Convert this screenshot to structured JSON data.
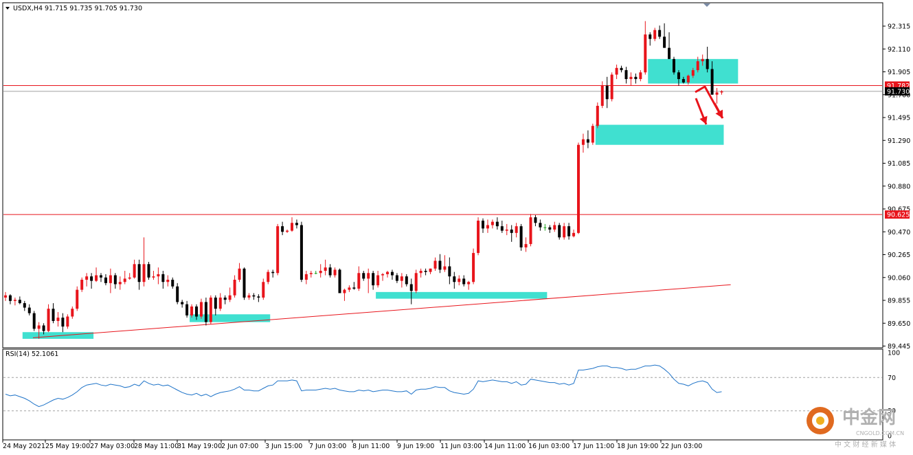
{
  "header": {
    "symbol": "USDX,H4",
    "ohlc": "91.715 91.735 91.705 91.730"
  },
  "rsi": {
    "label": "RSI(14) 52.1061",
    "levels": [
      100,
      70,
      30,
      0
    ]
  },
  "price_labels": {
    "resistance_high": "91.782",
    "current": "91.730",
    "resistance_low": "90.625"
  },
  "colors": {
    "bull": "#e8141b",
    "bear": "#000000",
    "doji": "#19a019",
    "zone": "#40e0d0",
    "line": "#e8141b",
    "rsi": "#1e73c8"
  },
  "watermark": {
    "brand": "中金网",
    "sub": "中 文 财 经 新 媒 体",
    "url": "CNGOLD.COM.CN"
  },
  "chart_data": [
    {
      "type": "candlestick",
      "title": "USDX,H4",
      "ylim": [
        89.4,
        92.4
      ],
      "y_ticks": [
        92.315,
        92.11,
        91.905,
        91.7,
        91.495,
        91.29,
        91.085,
        90.88,
        90.675,
        90.47,
        90.265,
        90.06,
        89.855,
        89.65,
        89.445
      ],
      "x_ticks": [
        "24 May 2021",
        "25 May 19:00",
        "27 May 03:00",
        "28 May 11:00",
        "31 May 19:00",
        "2 Jun 07:00",
        "3 Jun 15:00",
        "7 Jun 03:00",
        "8 Jun 11:00",
        "9 Jun 19:00",
        "11 Jun 03:00",
        "14 Jun 11:00",
        "16 Jun 03:00",
        "17 Jun 11:00",
        "18 Jun 19:00",
        "22 Jun 03:00"
      ],
      "horizontal_lines": [
        91.782,
        91.73,
        90.625
      ],
      "trendline": [
        [
          89.52,
          0
        ],
        [
          89.995,
          147
        ]
      ],
      "zones": [
        {
          "from": 4,
          "to": 18,
          "low": 89.51,
          "high": 89.57
        },
        {
          "from": 39,
          "to": 55,
          "low": 89.66,
          "high": 89.73
        },
        {
          "from": 78,
          "to": 113,
          "low": 89.87,
          "high": 89.93
        },
        {
          "from": 124,
          "to": 150,
          "low": 91.25,
          "high": 91.43
        },
        {
          "from": 135,
          "to": 153,
          "low": 91.8,
          "high": 92.02
        }
      ],
      "ohlc": [
        [
          89.88,
          89.93,
          89.85,
          89.9
        ],
        [
          89.9,
          89.91,
          89.82,
          89.85
        ],
        [
          89.85,
          89.88,
          89.81,
          89.86
        ],
        [
          89.86,
          89.89,
          89.82,
          89.83
        ],
        [
          89.83,
          89.85,
          89.76,
          89.79
        ],
        [
          89.79,
          89.82,
          89.72,
          89.74
        ],
        [
          89.74,
          89.76,
          89.58,
          89.6
        ],
        [
          89.6,
          89.66,
          89.51,
          89.63
        ],
        [
          89.63,
          89.65,
          89.55,
          89.58
        ],
        [
          89.58,
          89.82,
          89.57,
          89.78
        ],
        [
          89.78,
          89.83,
          89.65,
          89.67
        ],
        [
          89.67,
          89.75,
          89.62,
          89.7
        ],
        [
          89.7,
          89.74,
          89.57,
          89.62
        ],
        [
          89.62,
          89.73,
          89.6,
          89.71
        ],
        [
          89.71,
          89.8,
          89.69,
          89.78
        ],
        [
          89.78,
          89.98,
          89.76,
          89.95
        ],
        [
          89.95,
          90.06,
          89.93,
          90.04
        ],
        [
          90.04,
          90.1,
          89.98,
          90.07
        ],
        [
          90.07,
          90.1,
          89.96,
          90.03
        ],
        [
          90.03,
          90.15,
          90.02,
          90.08
        ],
        [
          90.08,
          90.1,
          90.02,
          90.06
        ],
        [
          90.06,
          90.09,
          89.99,
          90.01
        ],
        [
          90.01,
          90.14,
          89.92,
          90.08
        ],
        [
          90.08,
          90.1,
          89.96,
          90.0
        ],
        [
          90.0,
          90.07,
          89.95,
          90.02
        ],
        [
          90.02,
          90.12,
          90.0,
          90.05
        ],
        [
          90.05,
          90.1,
          90.04,
          90.06
        ],
        [
          90.06,
          90.22,
          90.05,
          90.18
        ],
        [
          90.18,
          90.22,
          89.95,
          90.02
        ],
        [
          90.02,
          90.42,
          89.98,
          90.18
        ],
        [
          90.18,
          90.2,
          90.04,
          90.06
        ],
        [
          90.06,
          90.12,
          90.04,
          90.07
        ],
        [
          90.07,
          90.15,
          90.0,
          90.09
        ],
        [
          90.09,
          90.12,
          89.96,
          90.02
        ],
        [
          90.02,
          90.08,
          89.98,
          90.04
        ],
        [
          90.04,
          90.06,
          89.96,
          89.98
        ],
        [
          89.98,
          90.01,
          89.82,
          89.84
        ],
        [
          89.84,
          89.86,
          89.79,
          89.82
        ],
        [
          89.82,
          89.85,
          89.7,
          89.72
        ],
        [
          89.72,
          89.82,
          89.7,
          89.8
        ],
        [
          89.8,
          89.82,
          89.68,
          89.71
        ],
        [
          89.71,
          89.87,
          89.69,
          89.84
        ],
        [
          89.84,
          89.88,
          89.63,
          89.66
        ],
        [
          89.66,
          89.9,
          89.64,
          89.88
        ],
        [
          89.88,
          89.9,
          89.72,
          89.78
        ],
        [
          89.78,
          89.92,
          89.76,
          89.88
        ],
        [
          89.88,
          89.9,
          89.82,
          89.86
        ],
        [
          89.86,
          89.97,
          89.84,
          89.9
        ],
        [
          89.9,
          90.08,
          89.88,
          90.04
        ],
        [
          90.04,
          90.19,
          90.02,
          90.14
        ],
        [
          90.14,
          90.15,
          89.86,
          89.88
        ],
        [
          89.88,
          89.92,
          89.86,
          89.9
        ],
        [
          89.9,
          89.92,
          89.86,
          89.89
        ],
        [
          89.89,
          89.91,
          89.84,
          89.88
        ],
        [
          89.88,
          90.05,
          89.86,
          90.02
        ],
        [
          90.02,
          90.13,
          90.0,
          90.11
        ],
        [
          90.11,
          90.13,
          90.06,
          90.1
        ],
        [
          90.1,
          90.54,
          90.08,
          90.52
        ],
        [
          90.52,
          90.56,
          90.44,
          90.47
        ],
        [
          90.47,
          90.49,
          90.46,
          90.48
        ],
        [
          90.48,
          90.6,
          90.47,
          90.55
        ],
        [
          90.55,
          90.58,
          90.5,
          90.53
        ],
        [
          90.53,
          90.56,
          90.02,
          90.04
        ],
        [
          90.04,
          90.12,
          90.0,
          90.09
        ],
        [
          90.09,
          90.12,
          90.06,
          90.1
        ],
        [
          90.1,
          90.12,
          90.09,
          90.1
        ],
        [
          90.1,
          90.18,
          90.06,
          90.12
        ],
        [
          90.12,
          90.22,
          90.08,
          90.15
        ],
        [
          90.15,
          90.18,
          90.06,
          90.08
        ],
        [
          90.08,
          90.15,
          90.06,
          90.13
        ],
        [
          90.13,
          90.14,
          89.95,
          89.92
        ],
        [
          89.92,
          89.96,
          89.85,
          89.95
        ],
        [
          89.95,
          89.99,
          89.93,
          89.97
        ],
        [
          89.97,
          90.02,
          89.95,
          89.96
        ],
        [
          89.96,
          90.16,
          89.94,
          90.1
        ],
        [
          90.1,
          90.12,
          90.03,
          90.05
        ],
        [
          90.05,
          90.14,
          89.92,
          90.1
        ],
        [
          90.1,
          90.12,
          89.95,
          89.99
        ],
        [
          89.99,
          90.12,
          89.97,
          90.08
        ],
        [
          90.08,
          90.1,
          90.03,
          90.09
        ],
        [
          90.09,
          90.12,
          90.06,
          90.11
        ],
        [
          90.11,
          90.13,
          90.04,
          90.08
        ],
        [
          90.08,
          90.1,
          90.01,
          90.03
        ],
        [
          90.03,
          90.1,
          89.97,
          90.07
        ],
        [
          90.07,
          90.09,
          89.98,
          90.0
        ],
        [
          90.0,
          90.05,
          89.82,
          89.94
        ],
        [
          89.94,
          90.13,
          89.92,
          90.1
        ],
        [
          90.1,
          90.14,
          90.06,
          90.12
        ],
        [
          90.12,
          90.14,
          90.08,
          90.11
        ],
        [
          90.11,
          90.14,
          90.09,
          90.14
        ],
        [
          90.14,
          90.24,
          90.12,
          90.21
        ],
        [
          90.21,
          90.27,
          90.1,
          90.13
        ],
        [
          90.13,
          90.26,
          90.11,
          90.16
        ],
        [
          90.16,
          90.24,
          90.0,
          90.07
        ],
        [
          90.07,
          90.11,
          89.96,
          90.02
        ],
        [
          90.02,
          90.08,
          89.99,
          90.05
        ],
        [
          90.05,
          90.08,
          89.98,
          90.0
        ],
        [
          90.0,
          90.03,
          89.95,
          90.02
        ],
        [
          90.02,
          90.32,
          90.0,
          90.28
        ],
        [
          90.28,
          90.6,
          90.26,
          90.57
        ],
        [
          90.57,
          90.59,
          90.46,
          90.5
        ],
        [
          90.5,
          90.58,
          90.46,
          90.53
        ],
        [
          90.53,
          90.58,
          90.5,
          90.56
        ],
        [
          90.56,
          90.6,
          90.49,
          90.52
        ],
        [
          90.52,
          90.57,
          90.46,
          90.48
        ],
        [
          90.48,
          90.54,
          90.44,
          90.49
        ],
        [
          90.49,
          90.53,
          90.38,
          90.46
        ],
        [
          90.46,
          90.55,
          90.42,
          90.52
        ],
        [
          90.52,
          90.54,
          90.3,
          90.33
        ],
        [
          90.33,
          90.42,
          90.29,
          90.36
        ],
        [
          90.36,
          90.63,
          90.34,
          90.6
        ],
        [
          90.6,
          90.62,
          90.52,
          90.55
        ],
        [
          90.55,
          90.58,
          90.48,
          90.51
        ],
        [
          90.51,
          90.54,
          90.48,
          90.51
        ],
        [
          90.51,
          90.53,
          90.46,
          90.49
        ],
        [
          90.49,
          90.56,
          90.47,
          90.53
        ],
        [
          90.53,
          90.55,
          90.4,
          90.42
        ],
        [
          90.42,
          90.55,
          90.4,
          90.52
        ],
        [
          90.52,
          90.55,
          90.4,
          90.43
        ],
        [
          90.43,
          90.49,
          90.42,
          90.46
        ],
        [
          90.46,
          91.27,
          90.45,
          91.25
        ],
        [
          91.25,
          91.35,
          91.18,
          91.3
        ],
        [
          91.3,
          91.38,
          91.22,
          91.27
        ],
        [
          91.27,
          91.44,
          91.25,
          91.42
        ],
        [
          91.42,
          91.63,
          91.4,
          91.6
        ],
        [
          91.6,
          91.82,
          91.58,
          91.78
        ],
        [
          91.78,
          91.86,
          91.58,
          91.66
        ],
        [
          91.66,
          91.9,
          91.64,
          91.88
        ],
        [
          91.88,
          91.97,
          91.84,
          91.94
        ],
        [
          91.94,
          91.96,
          91.9,
          91.92
        ],
        [
          91.92,
          91.95,
          91.8,
          91.84
        ],
        [
          91.84,
          91.9,
          91.78,
          91.86
        ],
        [
          91.86,
          91.89,
          91.8,
          91.84
        ],
        [
          91.84,
          91.92,
          91.82,
          91.9
        ],
        [
          91.9,
          92.36,
          91.88,
          92.24
        ],
        [
          92.24,
          92.26,
          92.14,
          92.2
        ],
        [
          92.2,
          92.3,
          92.18,
          92.28
        ],
        [
          92.28,
          92.32,
          92.2,
          92.22
        ],
        [
          92.22,
          92.34,
          92.14,
          92.12
        ],
        [
          92.12,
          92.26,
          92.08,
          92.02
        ],
        [
          92.02,
          92.04,
          91.88,
          91.9
        ],
        [
          91.9,
          91.92,
          91.78,
          91.84
        ],
        [
          91.84,
          91.86,
          91.8,
          91.81
        ],
        [
          91.81,
          91.88,
          91.79,
          91.87
        ],
        [
          91.87,
          91.94,
          91.85,
          91.92
        ],
        [
          91.92,
          92.04,
          91.9,
          92.0
        ],
        [
          92.0,
          92.06,
          91.96,
          92.02
        ],
        [
          92.02,
          92.13,
          91.9,
          91.93
        ],
        [
          91.93,
          92.0,
          91.7,
          91.7
        ],
        [
          91.7,
          91.76,
          91.62,
          91.72
        ],
        [
          91.72,
          91.74,
          91.7,
          91.73
        ]
      ]
    },
    {
      "type": "line",
      "title": "RSI(14) 52.1061",
      "ylim": [
        0,
        100
      ],
      "levels": [
        70,
        30
      ],
      "values": [
        50,
        48,
        49,
        47,
        45,
        42,
        38,
        35,
        37,
        40,
        43,
        45,
        44,
        46,
        49,
        53,
        58,
        61,
        62,
        63,
        61,
        60,
        62,
        61,
        60,
        58,
        59,
        62,
        60,
        66,
        63,
        61,
        62,
        60,
        61,
        58,
        55,
        52,
        50,
        49,
        51,
        48,
        50,
        47,
        50,
        52,
        53,
        54,
        56,
        59,
        55,
        55,
        54,
        54,
        57,
        60,
        61,
        66,
        66,
        66,
        67,
        66,
        54,
        55,
        55,
        55,
        56,
        57,
        56,
        57,
        55,
        54,
        53,
        53,
        55,
        54,
        55,
        53,
        54,
        55,
        55,
        54,
        53,
        53,
        54,
        50,
        55,
        56,
        56,
        57,
        59,
        58,
        58,
        54,
        52,
        51,
        50,
        51,
        56,
        66,
        65,
        66,
        67,
        66,
        65,
        65,
        63,
        65,
        61,
        62,
        68,
        67,
        66,
        65,
        64,
        64,
        62,
        63,
        61,
        63,
        79,
        79,
        80,
        81,
        83,
        84,
        84,
        82,
        82,
        81,
        79,
        80,
        80,
        82,
        84,
        84,
        85,
        84,
        80,
        75,
        68,
        63,
        62,
        60,
        63,
        65,
        66,
        64,
        56,
        52,
        53
      ]
    }
  ]
}
